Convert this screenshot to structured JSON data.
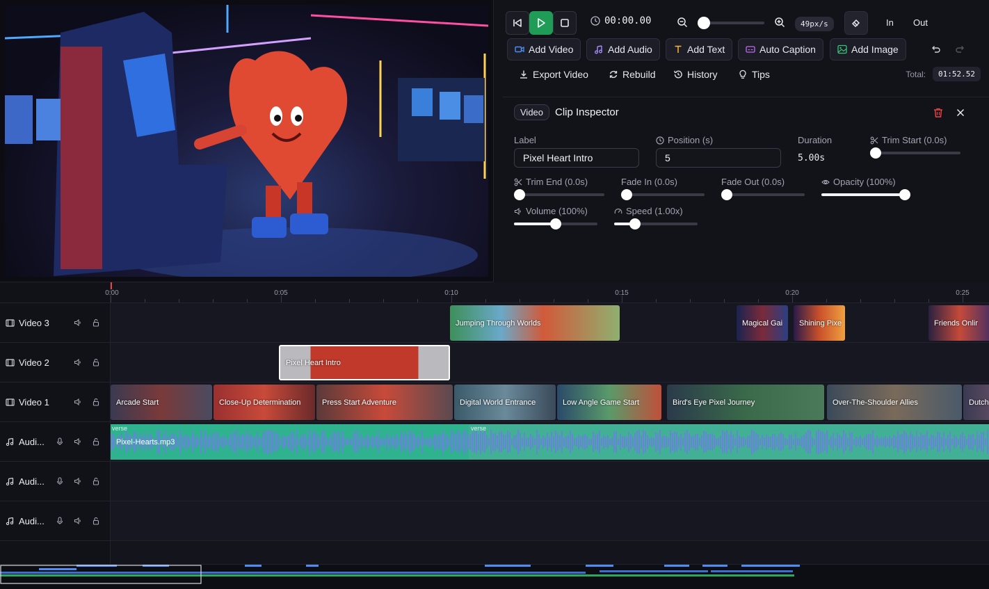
{
  "transport": {
    "time": "00:00.00",
    "zoom": "49px/s",
    "in_label": "In",
    "out_label": "Out"
  },
  "toolbar": {
    "add_video": "Add Video",
    "add_audio": "Add Audio",
    "add_text": "Add Text",
    "auto_caption": "Auto Caption",
    "add_image": "Add Image",
    "export_video": "Export Video",
    "rebuild": "Rebuild",
    "history": "History",
    "tips": "Tips",
    "total_label": "Total:",
    "total_value": "01:52.52"
  },
  "inspector": {
    "tag": "Video",
    "title": "Clip Inspector",
    "label_label": "Label",
    "label_value": "Pixel Heart Intro",
    "position_label": "Position (s)",
    "position_value": "5",
    "duration_label": "Duration",
    "duration_value": "5.00s",
    "trim_start_label": "Trim Start (0.0s)",
    "trim_end_label": "Trim End (0.0s)",
    "fade_in_label": "Fade In (0.0s)",
    "fade_out_label": "Fade Out (0.0s)",
    "opacity_label": "Opacity (100%)",
    "volume_label": "Volume (100%)",
    "speed_label": "Speed (1.00x)"
  },
  "sliders": {
    "trim_start": 0,
    "trim_end": 0,
    "fade_in": 0,
    "fade_out": 0,
    "opacity": 1.0,
    "volume": 0.5,
    "speed": 0.25,
    "zoom": 0.1
  },
  "ruler": {
    "labels": [
      "0:00",
      "0:05",
      "0:10",
      "0:15",
      "0:20",
      "0:25"
    ]
  },
  "tracks": [
    {
      "name": "Video 3",
      "kind": "video"
    },
    {
      "name": "Video 2",
      "kind": "video"
    },
    {
      "name": "Video 1",
      "kind": "video"
    },
    {
      "name": "Audi...",
      "kind": "audio"
    },
    {
      "name": "Audi...",
      "kind": "audio"
    },
    {
      "name": "Audi...",
      "kind": "audio"
    }
  ],
  "clips": {
    "video3": [
      "Jumping Through Worlds",
      "Magical Gai",
      "Shining Pixe",
      "Friends Onlir"
    ],
    "video2": [
      "Pixel Heart Intro"
    ],
    "video1": [
      "Arcade Start",
      "Close-Up Determination",
      "Press Start Adventure",
      "Digital World Entrance",
      "Low Angle Game Start",
      "Bird's Eye Pixel Journey",
      "Over-The-Shoulder Allies",
      "Dutch"
    ],
    "audio1": {
      "name": "Pixel-Hearts.mp3",
      "section1": "verse",
      "section2": "verse"
    }
  },
  "colors": {
    "accent_green": "#1f9d57",
    "audio_clip": "#2fb38e",
    "waveform": "#6b7fe0",
    "selected_border": "#ffffff"
  }
}
